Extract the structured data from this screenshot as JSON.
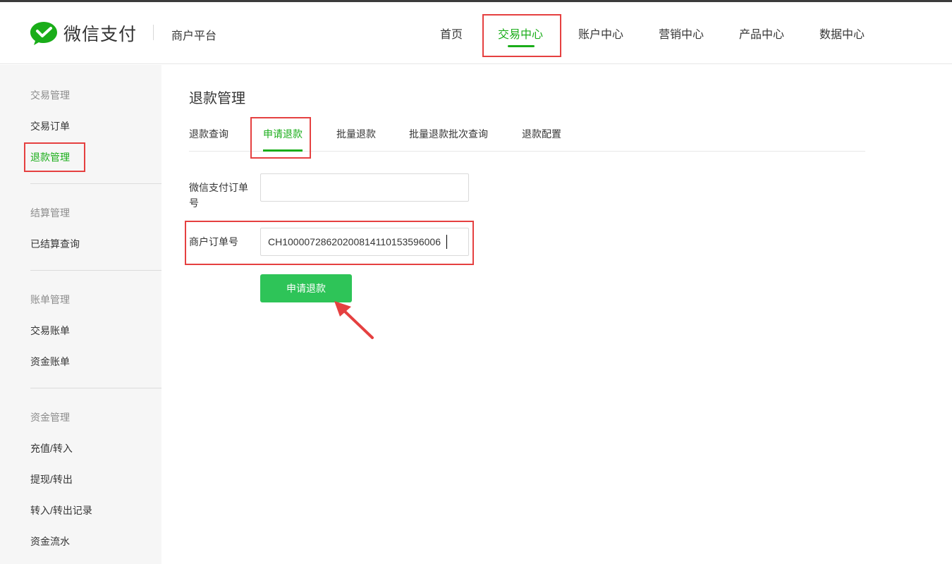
{
  "header": {
    "brand": "微信支付",
    "platform": "商户平台",
    "nav": [
      "首页",
      "交易中心",
      "账户中心",
      "营销中心",
      "产品中心",
      "数据中心"
    ],
    "active_nav": "交易中心"
  },
  "sidebar": {
    "groups": [
      {
        "title": "交易管理",
        "items": [
          "交易订单",
          "退款管理"
        ]
      },
      {
        "title": "结算管理",
        "items": [
          "已结算查询"
        ]
      },
      {
        "title": "账单管理",
        "items": [
          "交易账单",
          "资金账单"
        ]
      },
      {
        "title": "资金管理",
        "items": [
          "充值/转入",
          "提现/转出",
          "转入/转出记录",
          "资金流水"
        ]
      }
    ],
    "active_item": "退款管理"
  },
  "main": {
    "title": "退款管理",
    "tabs": [
      "退款查询",
      "申请退款",
      "批量退款",
      "批量退款批次查询",
      "退款配置"
    ],
    "active_tab": "申请退款",
    "form": {
      "wx_order_label": "微信支付订单号",
      "wx_order_value": "",
      "merchant_order_label": "商户订单号",
      "merchant_order_value": "CH10000728620200814110153596006"
    },
    "submit_label": "申请退款"
  },
  "colors": {
    "accent": "#1aad19",
    "button": "#2ec458",
    "highlight": "#e54040"
  }
}
